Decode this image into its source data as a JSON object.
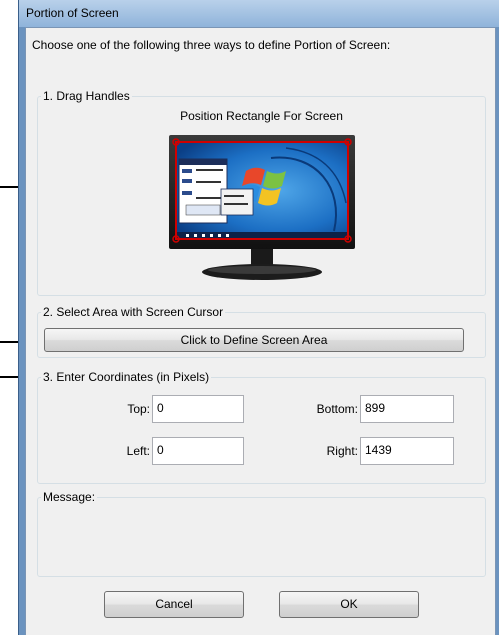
{
  "window": {
    "title": "Portion of Screen"
  },
  "intro": "Choose one of the following three ways to define Portion of Screen:",
  "drag_handles": {
    "legend": "1. Drag Handles",
    "caption": "Position Rectangle For Screen"
  },
  "select_area": {
    "legend": "2. Select Area with Screen Cursor",
    "button_label": "Click to Define Screen Area"
  },
  "coordinates": {
    "legend": "3. Enter Coordinates (in Pixels)",
    "top_label": "Top:",
    "top_value": "0",
    "bottom_label": "Bottom:",
    "bottom_value": "899",
    "left_label": "Left:",
    "left_value": "0",
    "right_label": "Right:",
    "right_value": "1439"
  },
  "message": {
    "legend": "Message:"
  },
  "buttons": {
    "cancel": "Cancel",
    "ok": "OK"
  },
  "colors": {
    "title_bar": "#a9c6e6",
    "frame": "#6b93bf",
    "handle": "#d00000",
    "panel": "#f0f0f0"
  }
}
